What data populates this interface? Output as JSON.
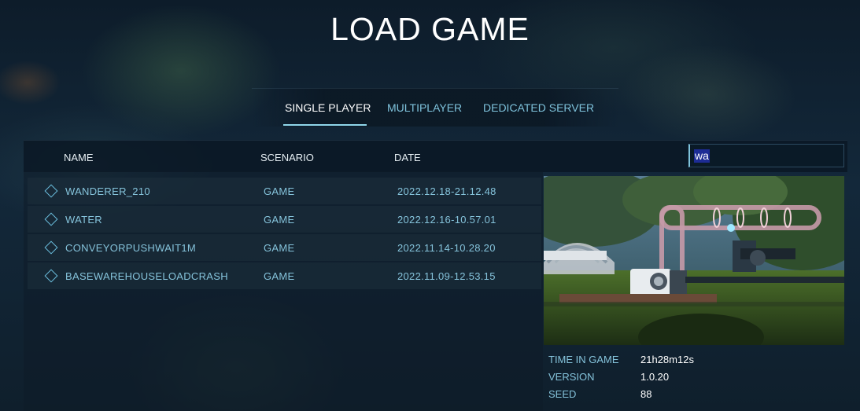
{
  "title": "LOAD GAME",
  "tabs": [
    {
      "label": "SINGLE PLAYER",
      "active": true
    },
    {
      "label": "MULTIPLAYER",
      "active": false
    },
    {
      "label": "DEDICATED SERVER",
      "active": false
    }
  ],
  "table": {
    "headers": {
      "name": "NAME",
      "scenario": "SCENARIO",
      "date": "DATE"
    },
    "search_value": "wa",
    "rows": [
      {
        "name": "WANDERER_210",
        "scenario": "GAME",
        "date": "2022.12.18-21.12.48"
      },
      {
        "name": "WATER",
        "scenario": "GAME",
        "date": "2022.12.16-10.57.01"
      },
      {
        "name": "CONVEYORPUSHWAIT1M",
        "scenario": "GAME",
        "date": "2022.11.14-10.28.20"
      },
      {
        "name": "BASEWAREHOUSELOADCRASH",
        "scenario": "GAME",
        "date": "2022.11.09-12.53.15"
      }
    ]
  },
  "details": {
    "time_in_game_label": "TIME IN GAME",
    "time_in_game": "21h28m12s",
    "version_label": "VERSION",
    "version": "1.0.20",
    "seed_label": "SEED",
    "seed": "88"
  },
  "colors": {
    "accent": "#7fc3dc",
    "active_tab": "#ffffff",
    "background": "#13283a"
  }
}
